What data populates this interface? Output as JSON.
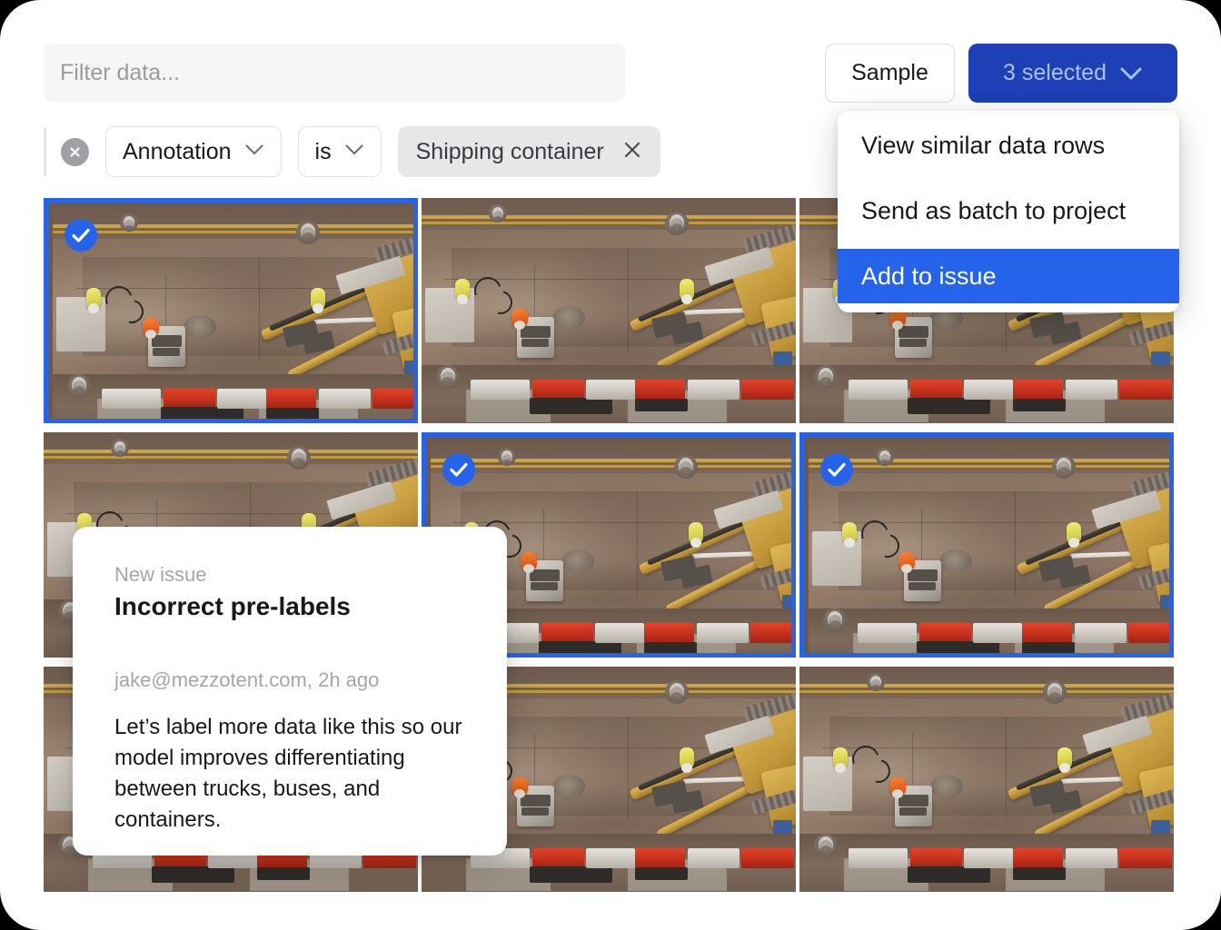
{
  "toolbar": {
    "filter_placeholder": "Filter data...",
    "filter_value": "",
    "sample_label": "Sample",
    "selected_label": "3 selected",
    "chevron_icon": "chevron-down-icon"
  },
  "filter_chip": {
    "remove_icon": "circle-x-icon",
    "field_label": "Annotation",
    "field_chevron": "chevron-down-icon",
    "operator_label": "is",
    "operator_chevron": "chevron-down-icon",
    "value_label": "Shipping container",
    "value_remove_icon": "x-icon"
  },
  "menu": {
    "items": [
      {
        "label": "View similar data rows",
        "active": false
      },
      {
        "label": "Send as batch to project",
        "active": false
      },
      {
        "label": "Add to issue",
        "active": true
      }
    ]
  },
  "issue_card": {
    "eyebrow": "New issue",
    "title": "Incorrect pre-labels",
    "meta": "jake@mezzotent.com, 2h ago",
    "body": "Let’s label more data like this so our model improves differentiating between trucks, buses, and containers."
  },
  "grid": {
    "check_icon": "check-icon",
    "items": [
      {
        "id": 1,
        "selected": true,
        "alt": "Aerial drone view of road construction site with excavator, workers and concrete barriers"
      },
      {
        "id": 2,
        "selected": false,
        "alt": "Aerial drone view of road construction site with excavator, workers and concrete barriers"
      },
      {
        "id": 3,
        "selected": false,
        "alt": "Aerial drone view of road construction site with excavator, workers and concrete barriers"
      },
      {
        "id": 4,
        "selected": false,
        "alt": "Aerial drone view of road construction site with excavator, workers and concrete barriers"
      },
      {
        "id": 5,
        "selected": true,
        "alt": "Aerial drone view of road construction site with excavator, workers and concrete barriers"
      },
      {
        "id": 6,
        "selected": true,
        "alt": "Aerial drone view of road construction site with excavator, workers and concrete barriers"
      },
      {
        "id": 7,
        "selected": false,
        "alt": "Aerial drone view of road construction site with excavator, workers and concrete barriers"
      },
      {
        "id": 8,
        "selected": false,
        "alt": "Aerial drone view of road construction site with excavator, workers and concrete barriers"
      },
      {
        "id": 9,
        "selected": false,
        "alt": "Aerial drone view of road construction site with excavator, workers and concrete barriers"
      }
    ]
  },
  "colors": {
    "accent_blue": "#2563eb",
    "button_blue": "#1e3fb5",
    "selected_text_blue": "#a9c2f5",
    "chip_gray": "#e7e7e9",
    "input_gray": "#f6f6f7",
    "muted_text": "#a6a6aa",
    "text": "#18181b"
  }
}
